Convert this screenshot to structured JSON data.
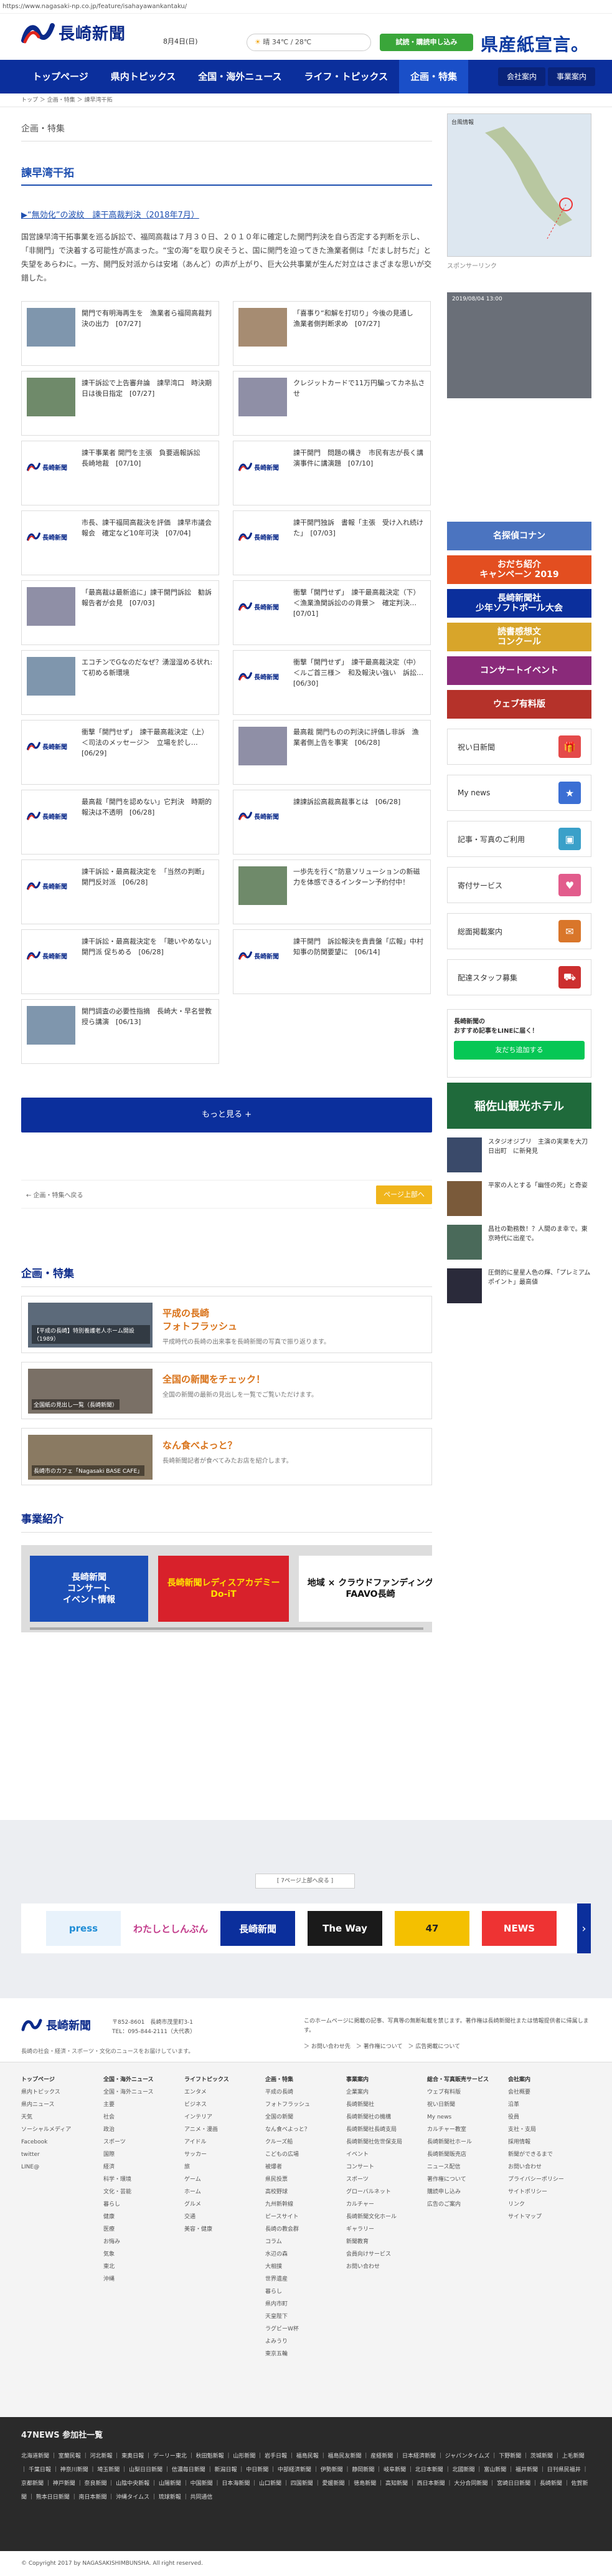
{
  "url": "https://www.nagasaki-np.co.jp/feature/isahayawankantaku/",
  "header": {
    "logo": "長崎新聞",
    "date": "8月4日(日)",
    "weather": "晴 34℃ / 28℃",
    "subscribe": "試読・購読申し込み",
    "promo": "県産紙宣言。"
  },
  "nav": {
    "items": [
      "トップページ",
      "県内トピックス",
      "全国・海外ニュース",
      "ライフ・トピックス",
      "企画・特集"
    ],
    "company": "会社案内",
    "business": "事業案内"
  },
  "breadcrumb": "トップ ＞ 企画・特集 ＞ 諫早湾干拓",
  "main": {
    "section": "企画・特集",
    "title": "諫早湾干拓",
    "lead_link": "▶“無効化”の波紋　諫干高裁判決（2018年7月）",
    "lead": "国営諫早湾干拓事業を巡る訴訟で、福岡高裁は７月３０日、２０１０年に確定した開門判決を自ら否定する判断を示し、「非開門」で決着する可能性が高まった。“宝の海”を取り戻そうと、国に開門を迫ってきた漁業者側は「だまし討ちだ」と失望をあらわに。一方、開門反対派からは安堵（あんど）の声が上がり、巨大公共事業が生んだ対立はさまざまな思いが交錯した。",
    "cards": [
      {
        "title": "開門で有明海再生を　漁業者ら福岡高裁判決の出力　[07/27]",
        "thumb": "photo"
      },
      {
        "title": "「喜事り“和解を打切り」今後の見通し　漁業者側判断求め　[07/27]",
        "thumb": "photo"
      },
      {
        "title": "諫干訴訟で上告審弁論　諫早湾口　時決期日は後日指定　[07/27]",
        "thumb": "photo"
      },
      {
        "title": "クレジットカードで11万円騙ってカネ払させ",
        "thumb": "photo"
      },
      {
        "title": "諫干事業者 開門を主張　負要過報訴訟　長崎地裁　[07/10]",
        "thumb": "brand"
      },
      {
        "title": "諫干開門　問題の構き　市民有志が長く講演事件に講演題　[07/10]",
        "thumb": "brand"
      },
      {
        "title": "市長、諫干福岡高裁決を評価　諫早市議会報会　確定など10年可決　[07/04]",
        "thumb": "brand"
      },
      {
        "title": "諫干開門独訴　書報「主張　受け入れ続けた」　[07/03]",
        "thumb": "brand"
      },
      {
        "title": "「最高裁は最新追に」諫干開門訴訟　勧訴報告者が会見　[07/03]",
        "thumb": "photo"
      },
      {
        "title": "衝撃「開門せず」　諫干最高裁決定（下）＜漁業漁関訴訟のの背景＞　確定判決…　[07/01]",
        "thumb": "brand"
      },
      {
        "title": "エコチンでGなのだなぜ？湧湿湿める状れ:て初める新環境",
        "thumb": "photo"
      },
      {
        "title": "衝撃「開門せず」　諫干最高裁決定（中）＜ルご首三様＞　和及報決い強い　訴訟…　[06/30]",
        "thumb": "brand"
      },
      {
        "title": "衝撃「開門せず」　諫干最高裁決定（上）＜司法のメッセージ＞　立場を於し…　[06/29]",
        "thumb": "brand"
      },
      {
        "title": "最高裁 開門ものの判決に評価し非訴　漁業者側上告を事実　[06/28]",
        "thumb": "photo"
      },
      {
        "title": "最高裁「開門を認めない」它判決　時期的報決は不透明　[06/28]",
        "thumb": "brand"
      },
      {
        "title": "諫諫訴訟高裁高裁事とは　[06/28]",
        "thumb": "brand"
      },
      {
        "title": "諫干訴訟・最高裁決定を　「当然の判断」開門反対派　[06/28]",
        "thumb": "brand"
      },
      {
        "title": "一歩先を行く“防意ソリューションの新磁力を体感できるインターン予約付中！",
        "thumb": "photo"
      },
      {
        "title": "諫干訴訟・最高裁決定を　「聴いやめない」開門派 促ちめる　[06/28]",
        "thumb": "brand"
      },
      {
        "title": "諫干開門　訴訟報決を貴貴盤「広報」中村知事の防関要望に　[06/14]",
        "thumb": "brand"
      },
      {
        "title": "開門調査の必要性指摘　長崎大・早名誉教授ら講演　[06/13]",
        "thumb": "photo"
      }
    ],
    "more": "もっと見る +",
    "back_link": "← 企画・特集へ戻る",
    "top_btn": "ページ上部へ",
    "feature_heading": "企画・特集",
    "features": [
      {
        "title": "平成の長崎\nフォトフラッシュ",
        "desc": "平成時代の長崎の出来事を長崎新聞の写真で振り返ります。",
        "caption": "【平成の長崎】特別養護老人ホーム開設（1989）"
      },
      {
        "title": "全国の新聞をチェック！",
        "desc": "全国の新聞の最新の見出しを一覧でご覧いただけます。",
        "caption": "全国紙の見出し一覧（長崎新聞）"
      },
      {
        "title": "なん食べよっと？",
        "desc": "長崎新聞記者が食べてみたお店を紹介します。",
        "caption": "長崎市のカフェ「Nagasaki BASE CAFE」"
      }
    ],
    "business_heading": "事業紹介",
    "business": [
      {
        "text": "長崎新聞\nコンサート\nイベント情報",
        "bg": "#1c4fb7",
        "fg": "#ffffff"
      },
      {
        "text": "長崎新聞レディスアカデミー\nDo-iT",
        "bg": "#d8212b",
        "fg": "#ffe100"
      },
      {
        "text": "地域 × クラウドファンディング\nFAAVO長崎",
        "bg": "#ffffff",
        "fg": "#111111"
      }
    ]
  },
  "side": {
    "map_label": "台風情報",
    "sp_link": "スポンサーリンク",
    "photo_label": "2019/08/04 13:00",
    "banners": [
      {
        "text": "名探偵コナン",
        "bg": "#4b74c0"
      },
      {
        "text": "おだち紹介\nキャンペーン 2019",
        "bg": "#e34e20"
      },
      {
        "text": "長崎新聞社\n少年ソフトボール大会",
        "bg": "#0b2f9c"
      },
      {
        "text": "読書感想文\nコンクール",
        "bg": "#d8a52a"
      },
      {
        "text": "コンサートイベント",
        "bg": "#8a2a7a"
      },
      {
        "text": "ウェブ有料版",
        "bg": "#b5322a"
      }
    ],
    "buttons": [
      {
        "label": "祝い日新聞",
        "color": "#e44a4a",
        "icon": "gift-icon"
      },
      {
        "label": "My news",
        "color": "#3b6fd4",
        "icon": "star-icon"
      },
      {
        "label": "記事・写真のご利用",
        "color": "#3aa0c9",
        "icon": "photo-icon"
      },
      {
        "label": "寄付サービス",
        "color": "#e25c8c",
        "icon": "heart-icon"
      },
      {
        "label": "総面掲載案内",
        "color": "#d9762a",
        "icon": "megaphone-icon"
      },
      {
        "label": "配達スタッフ募集",
        "color": "#cc2f2f",
        "icon": "bike-icon"
      }
    ],
    "line_title": "長崎新聞の\nおすすめ記事をLINEに届く！",
    "line_add": "友だち追加する",
    "hotel": "稲佐山観光ホテル",
    "sponsored": [
      {
        "text": "スタジオジブリ　主演の実果を大刀日出町　に新発見"
      },
      {
        "text": "平家の人とする「幽怪の死」と奇姿"
      },
      {
        "text": "昌社の勤務数！？人間のま幸で。東京時代に出産で。"
      },
      {
        "text": "圧倒的に星星人色の輝、「プレミアムポイント」最高値"
      }
    ]
  },
  "carousel": {
    "top": "[ 7ページ上部へ戻る ]",
    "items": [
      "press",
      "わたしとしんぶん",
      "長崎新聞",
      "The Way",
      "47",
      "NEWS"
    ]
  },
  "footer": {
    "logo": "長崎新聞",
    "address": "〒852-8601　長崎市茂里町3-1\nTEL：095-844-2111（大代表）",
    "desc": "長崎の社会・経済・スポーツ・文化のニュースをお届けしています。",
    "note": "このホームページに掲載の記事、写真等の無断転載を禁じます。著作権は長崎新聞社または情報提供者に帰属します。",
    "links": "＞ お問い合わせ先　＞ 著作権について　＞ 広告掲載について"
  },
  "sitemap": [
    {
      "head": "トップページ",
      "items": [
        "県内トピックス",
        "県内ニュース",
        "天気",
        "ソーシャルメディア",
        "Facebook",
        "twitter",
        "LINE@"
      ]
    },
    {
      "head": "全国・海外ニュース",
      "items": [
        "全国・海外ニュース",
        "主要",
        "社会",
        "政治",
        "スポーツ",
        "国際",
        "経済",
        "科学・環境",
        "文化・芸能",
        "暮らし",
        "健康",
        "医療",
        "お悔み",
        "気象",
        "東北",
        "沖縄"
      ]
    },
    {
      "head": "ライフトピックス",
      "items": [
        "エンタメ",
        "ビジネス",
        "インテリア",
        "アニメ・漫画",
        "アイドル",
        "サッカー",
        "旅",
        "ゲーム",
        "ホーム",
        "グルメ",
        "交通",
        "美容・健康"
      ]
    },
    {
      "head": "企画・特集",
      "items": [
        "平成の長崎",
        "フォトフラッシュ",
        "全国の新聞",
        "なん食べよっと？",
        "クルーズ船",
        "こどもの広場",
        "被爆者",
        "県民投票",
        "高校野球",
        "九州新幹線",
        "ピースサイト",
        "長崎の教会群",
        "コラム",
        "水辺の森",
        "大相撲",
        "世界遺産",
        "暮らし",
        "県内市町",
        "天皇陛下",
        "ラグビーW杯",
        "よみうり",
        "東京五輪"
      ]
    },
    {
      "head": "事業案内",
      "items": [
        "企業案内",
        "長崎新聞社",
        "長崎新聞社の機構",
        "長崎新聞社長崎支局",
        "長崎新聞社佐世保支局",
        "イベント",
        "コンサート",
        "スポーツ",
        "グローバルネット",
        "カルチャー",
        "長崎新聞文化ホール",
        "ギャラリー",
        "新聞教育",
        "会員向けサービス",
        "お問い合わせ"
      ]
    },
    {
      "head": "総合・写真販売サービス",
      "items": [
        "ウェブ有料版",
        "祝い日新聞",
        "My news",
        "カルチャー教室",
        "長崎新聞社ホール",
        "長崎新聞販売店",
        "ニュース配信",
        "著作権について",
        "購読申し込み",
        "広告のご案内"
      ]
    },
    {
      "head": "会社案内",
      "items": [
        "会社概要",
        "沿革",
        "役員",
        "支社・支局",
        "採用情報",
        "新聞ができるまで",
        "お問い合わせ",
        "プライバシーポリシー",
        "サイトポリシー",
        "リンク",
        "サイトマップ"
      ]
    }
  ],
  "n47": {
    "title": "47NEWS 参加社一覧",
    "list": "北海道新聞 ｜ 室蘭民報 ｜ 河北新報 ｜ 東奥日報 ｜ デーリー東北 ｜ 秋田魁新報 ｜ 山形新聞 ｜ 岩手日報 ｜ 福島民報 ｜ 福島民友新聞 ｜ 産経新聞 ｜ 日本経済新聞 ｜ ジャパンタイムズ ｜ 下野新聞 ｜ 茨城新聞 ｜ 上毛新聞 ｜ 千葉日報 ｜ 神奈川新聞 ｜ 埼玉新聞 ｜ 山梨日日新聞 ｜ 信濃毎日新聞 ｜ 新潟日報 ｜ 中日新聞 ｜ 中部経済新聞 ｜ 伊勢新聞 ｜ 静岡新聞 ｜ 岐阜新聞 ｜ 北日本新聞 ｜ 北國新聞 ｜ 富山新聞 ｜ 福井新聞 ｜ 日刊県民福井 ｜ 京都新聞 ｜ 神戸新聞 ｜ 奈良新聞 ｜ 山陰中央新報 ｜ 山陽新聞 ｜ 中国新聞 ｜ 日本海新聞 ｜ 山口新聞 ｜ 四国新聞 ｜ 愛媛新聞 ｜ 徳島新聞 ｜ 高知新聞 ｜ 西日本新聞 ｜ 大分合同新聞 ｜ 宮崎日日新聞 ｜ 長崎新聞 ｜ 佐賀新聞 ｜ 熊本日日新聞 ｜ 南日本新聞 ｜ 沖縄タイムス ｜ 琉球新報 ｜ 共同通信"
  },
  "copyright": "© Copyright 2017 by NAGASAKISHIMBUNSHA. All right reserved."
}
